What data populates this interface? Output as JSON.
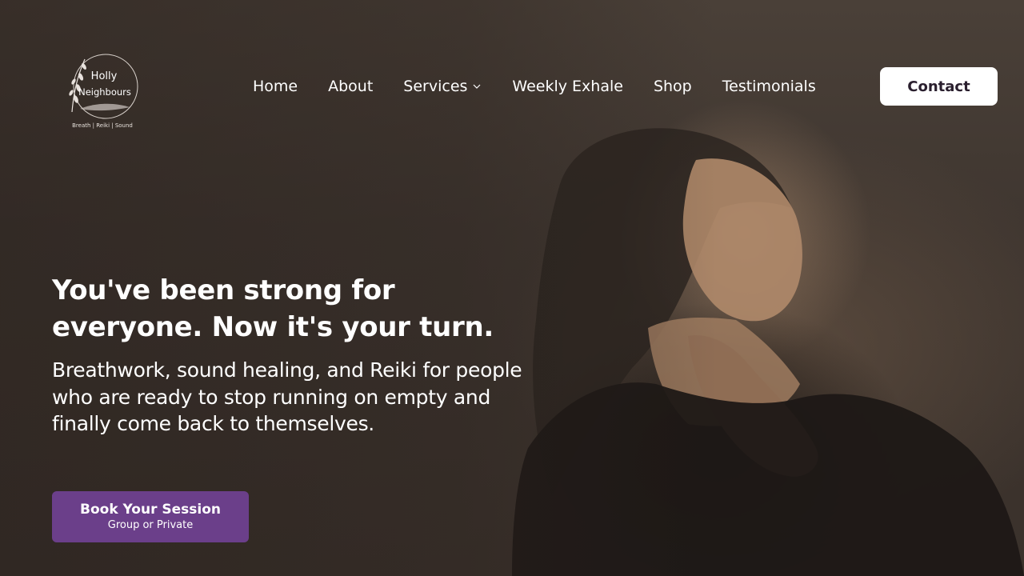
{
  "brand": {
    "name_line1": "Holly",
    "name_line2": "Neighbours",
    "tagline": "Breath | Reiki | Sound",
    "logo_icon": "feather-leaf-icon"
  },
  "nav": {
    "items": [
      {
        "label": "Home"
      },
      {
        "label": "About"
      },
      {
        "label": "Services",
        "has_dropdown": true
      },
      {
        "label": "Weekly Exhale"
      },
      {
        "label": "Shop"
      },
      {
        "label": "Testimonials"
      }
    ],
    "contact_label": "Contact"
  },
  "hero": {
    "headline_line1": "You've been strong for",
    "headline_line2": "everyone. Now it's your turn.",
    "subtext": "Breathwork, sound healing, and Reiki for people who are ready to stop running on empty and finally come back to themselves.",
    "cta_label": "Book Your Session",
    "cta_sublabel": "Group or Private"
  },
  "colors": {
    "cta_background": "#6b3f8a",
    "contact_background": "#ffffff",
    "contact_text": "#2a1f2e",
    "text": "#ffffff"
  }
}
